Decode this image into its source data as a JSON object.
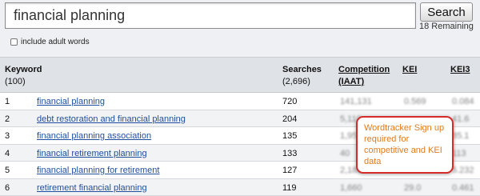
{
  "search": {
    "value": "financial planning",
    "button_label": "Search",
    "remaining": "18 Remaining",
    "adult_label": "include adult words"
  },
  "table": {
    "headers": {
      "keyword": "Keyword",
      "keyword_count": "(100)",
      "searches": "Searches",
      "searches_total": "(2,696)",
      "competition": "Competition",
      "competition_sub": "(IAAT)",
      "kei": "KEI",
      "kei3": "KEI3"
    },
    "rows": [
      {
        "num": "1",
        "keyword": "financial planning",
        "searches": "720",
        "competition": "141,131",
        "kei": "0.569",
        "kei3": "0.084"
      },
      {
        "num": "2",
        "keyword": "debt restoration and financial planning",
        "searches": "204",
        "competition": "5,110",
        "kei": "",
        "kei3": "41.6"
      },
      {
        "num": "3",
        "keyword": "financial planning association",
        "searches": "135",
        "competition": "1,950",
        "kei": "",
        "kei3": "85.1"
      },
      {
        "num": "4",
        "keyword": "financial retirement planning",
        "searches": "133",
        "competition": "40",
        "kei": "",
        "kei3": "113"
      },
      {
        "num": "5",
        "keyword": "financial planning for retirement",
        "searches": "127",
        "competition": "2,180",
        "kei": "",
        "kei3": "5.232"
      },
      {
        "num": "6",
        "keyword": "retirement financial planning",
        "searches": "119",
        "competition": "1,660",
        "kei": "29.0",
        "kei3": "0.461"
      }
    ]
  },
  "tooltip": {
    "text": "Wordtracker Sign up required for competitive and KEI data"
  }
}
